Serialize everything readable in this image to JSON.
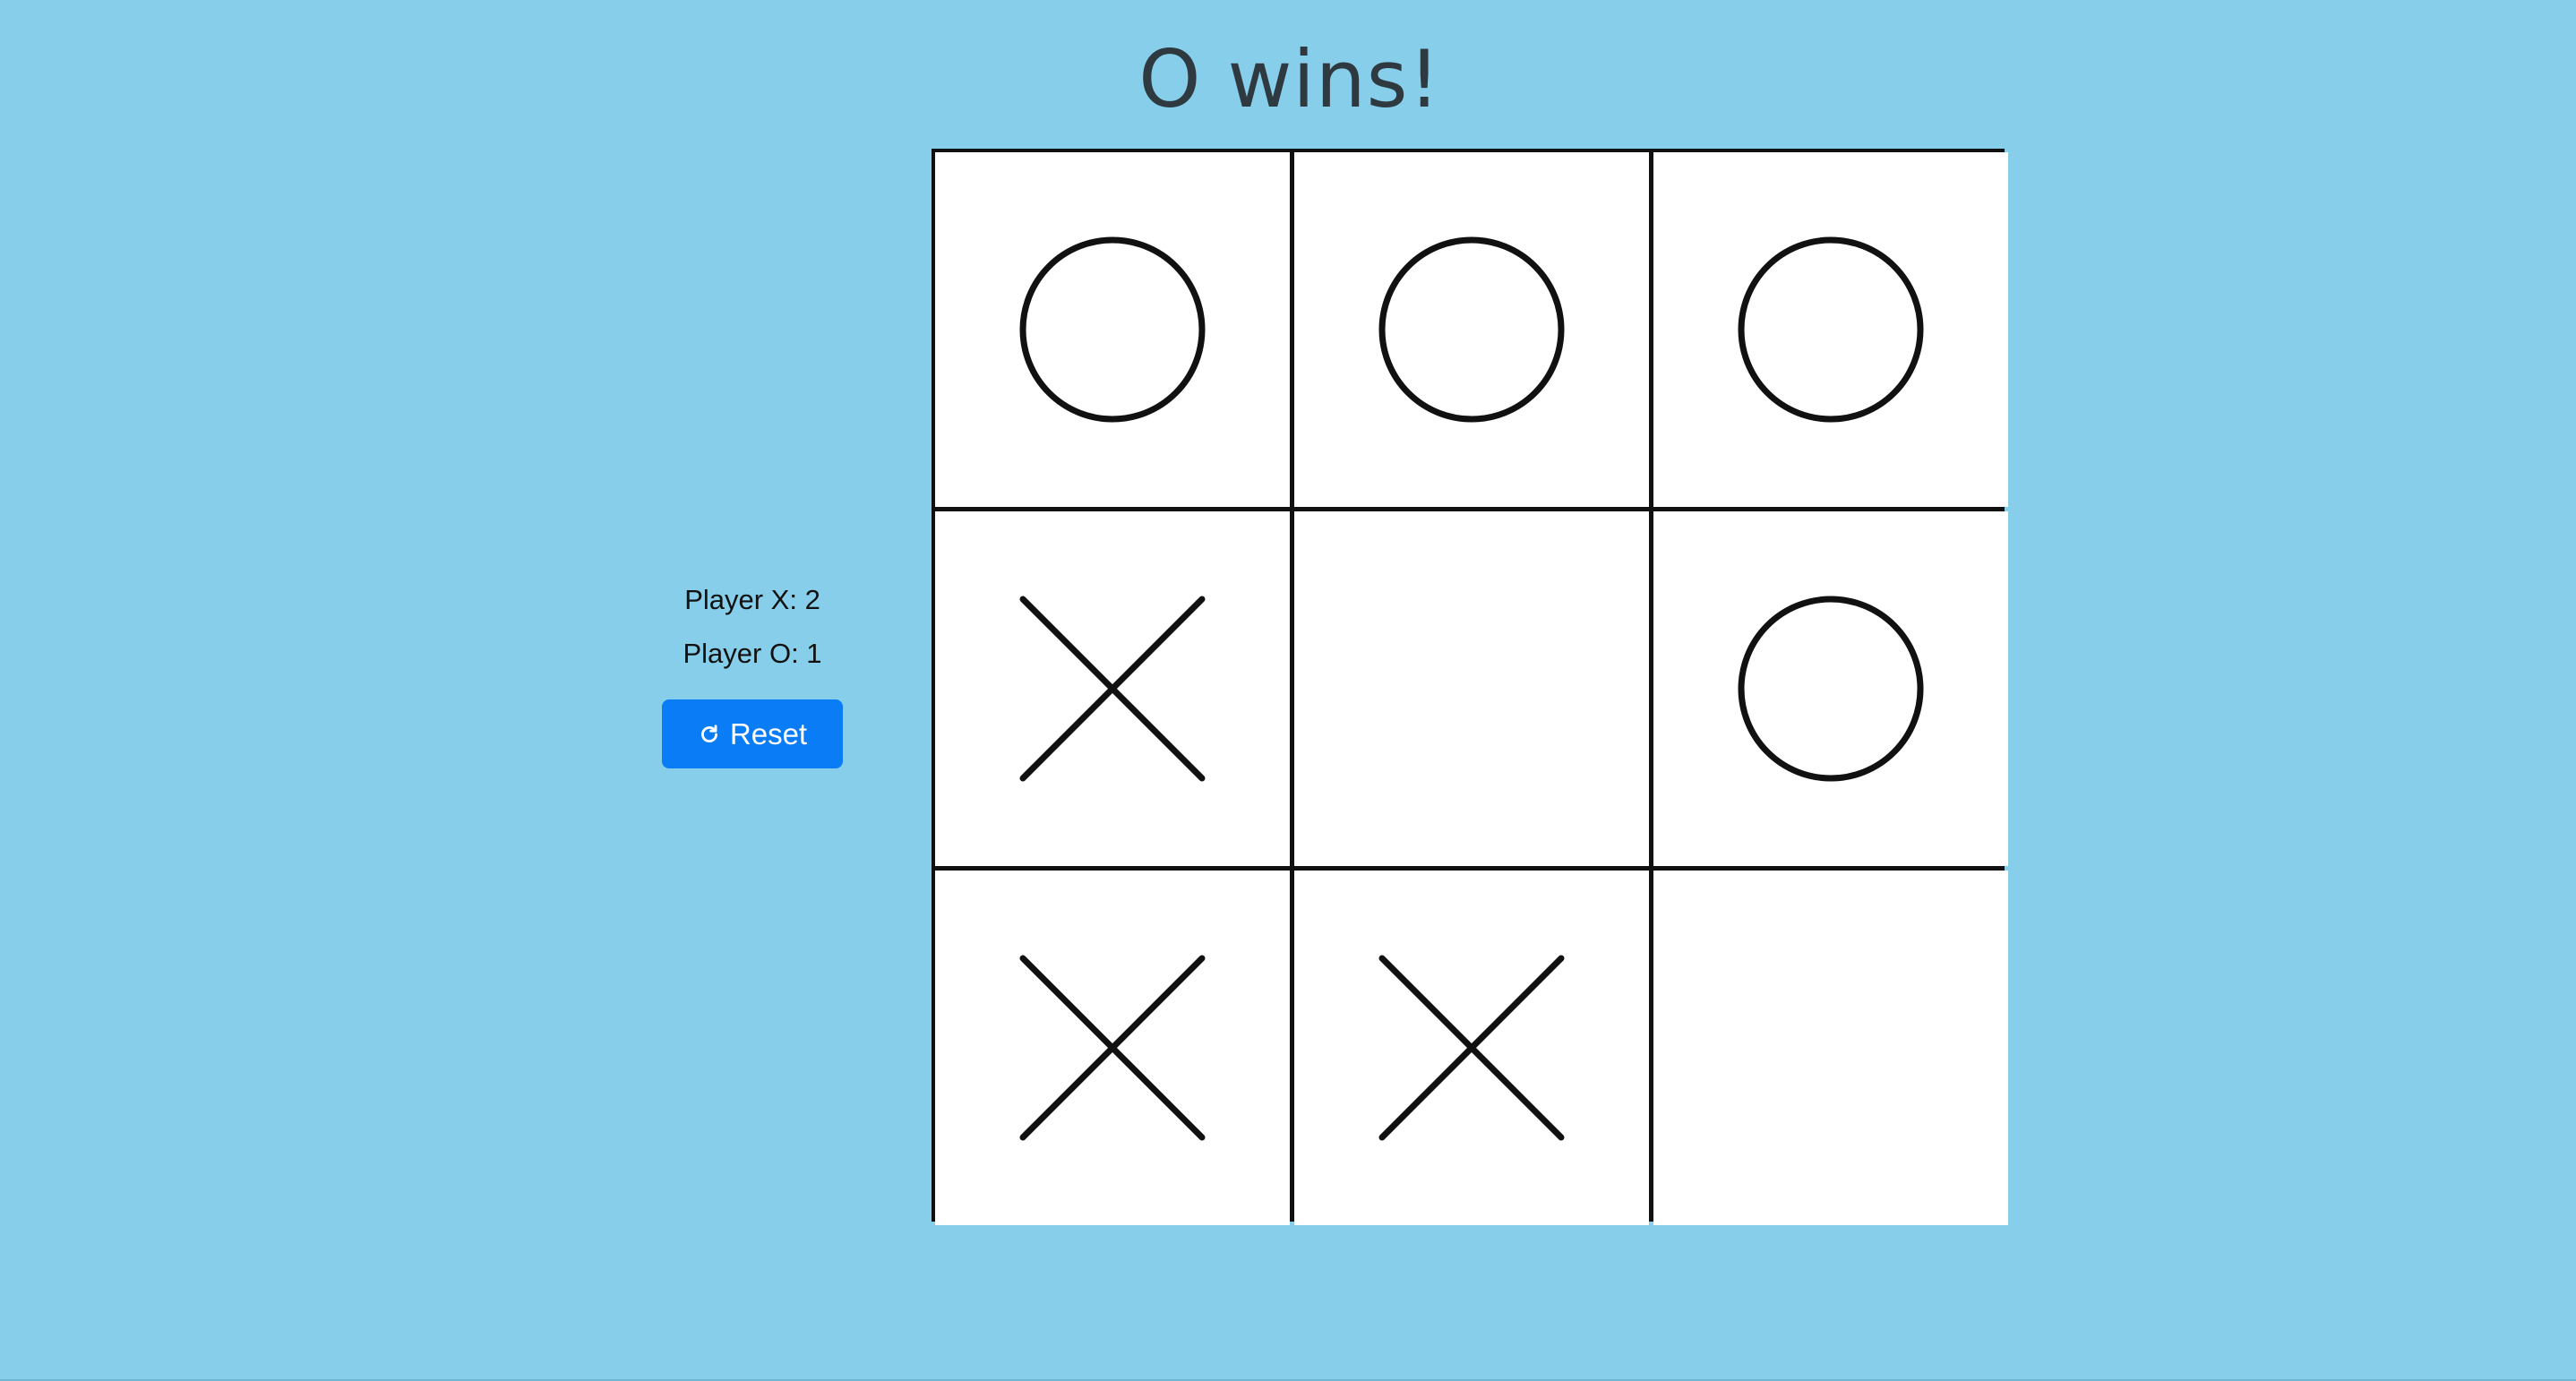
{
  "status": {
    "message": "O wins!"
  },
  "scores": {
    "player_x": "Player X: 2",
    "player_o": "Player O: 1"
  },
  "controls": {
    "reset_label": "Reset",
    "reset_icon": "refresh-icon"
  },
  "board": {
    "cells": [
      "O",
      "O",
      "O",
      "X",
      "",
      "O",
      "X",
      "X",
      ""
    ]
  },
  "colors": {
    "background": "#87ceeb",
    "button": "#0a7cf5",
    "marks": "#111111",
    "cell": "#ffffff"
  }
}
